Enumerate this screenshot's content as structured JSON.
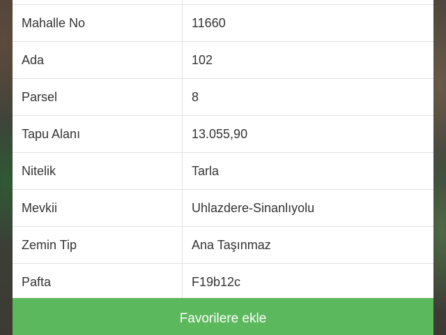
{
  "details_table": {
    "rows": [
      {
        "label": "Mahalle No",
        "value": "11660"
      },
      {
        "label": "Ada",
        "value": "102"
      },
      {
        "label": "Parsel",
        "value": "8"
      },
      {
        "label": "Tapu Alanı",
        "value": "13.055,90"
      },
      {
        "label": "Nitelik",
        "value": "Tarla"
      },
      {
        "label": "Mevkii",
        "value": "Uhlazdere-Sinanlıyolu"
      },
      {
        "label": "Zemin Tip",
        "value": "Ana Taşınmaz"
      },
      {
        "label": "Pafta",
        "value": "F19b12c"
      }
    ]
  },
  "actions": {
    "add_favorite_label": "Favorilere ekle"
  },
  "colors": {
    "button_green": "#5cb85c",
    "divider": "#e2e2e2",
    "text": "#333333"
  }
}
